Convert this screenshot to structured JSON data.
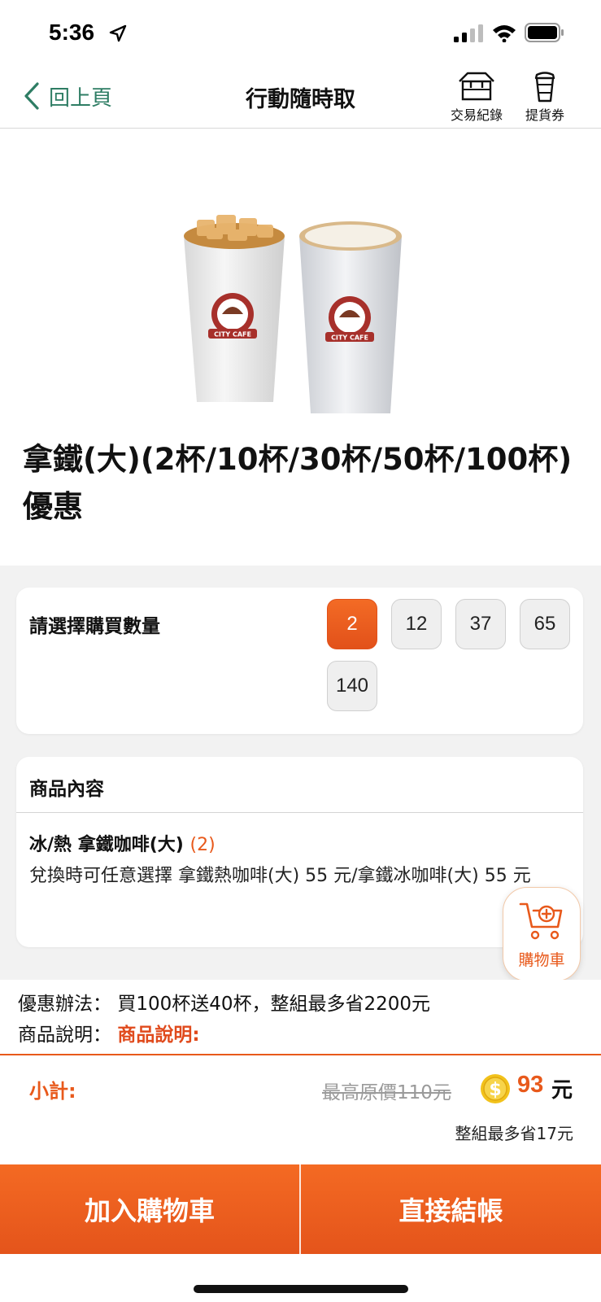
{
  "status_bar": {
    "time": "5:36"
  },
  "nav": {
    "back_label": "回上頁",
    "title": "行動隨時取",
    "transactions_label": "交易紀錄",
    "vouchers_label": "提貨券"
  },
  "product": {
    "title": "拿鐵(大)(2杯/10杯/30杯/50杯/100杯)優惠",
    "cup_brand": "CITY CAFE"
  },
  "quantity": {
    "label": "請選擇購買數量",
    "options": [
      "2",
      "12",
      "37",
      "65",
      "140"
    ],
    "selected": "2"
  },
  "content": {
    "heading": "商品內容",
    "item_name": "冰/熱 拿鐵咖啡(大)",
    "item_count": "(2)",
    "description": "兌換時可任意選擇 拿鐵熱咖啡(大) 55 元/拿鐵冰咖啡(大) 55 元"
  },
  "floating_cart": {
    "label": "購物車"
  },
  "promo": {
    "method_label": "優惠辦法：",
    "method_text": "買100杯送40杯，整組最多省2200元",
    "desc_label": "商品說明：",
    "desc_link": "商品說明:"
  },
  "subtotal": {
    "label": "小計:",
    "original_price": "最高原價110元",
    "price": "93",
    "unit": "元",
    "savings": "整組最多省17元"
  },
  "actions": {
    "add_to_cart": "加入購物車",
    "checkout": "直接結帳"
  },
  "colors": {
    "accent": "#e8591b",
    "nav_green": "#2e7d64",
    "coin": "#f2c21b"
  }
}
